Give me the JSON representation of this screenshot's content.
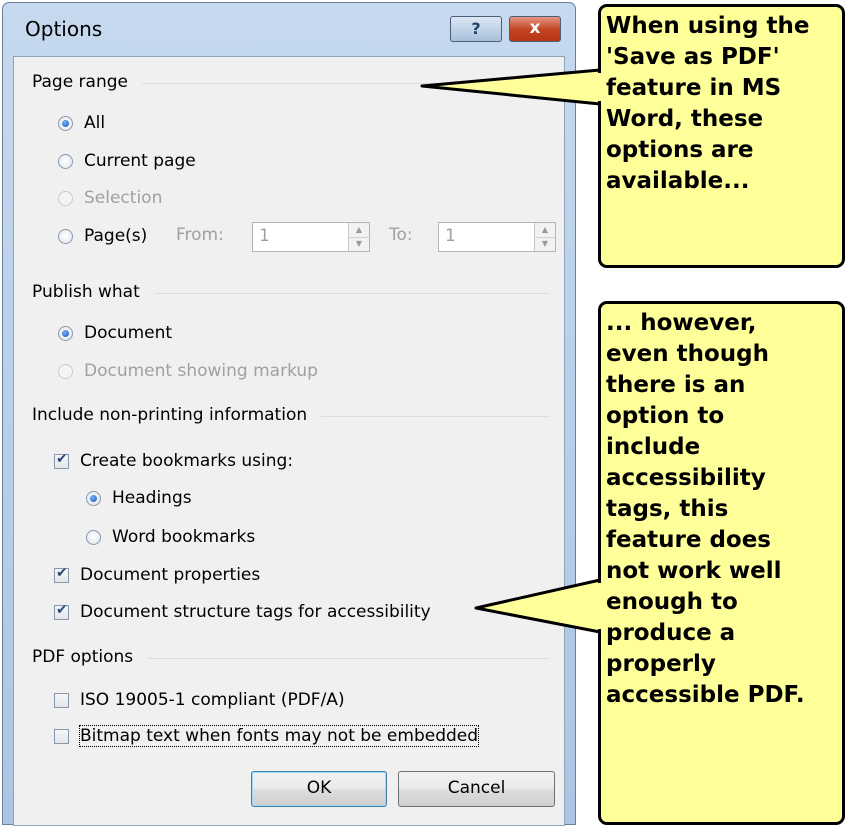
{
  "dialog": {
    "title": "Options",
    "help_glyph": "?",
    "close_glyph": "x"
  },
  "page_range": {
    "header": "Page range",
    "all_label": "All",
    "current_page_label": "Current page",
    "selection_label": "Selection",
    "pages_label": "Page(s)",
    "from_label": "From:",
    "from_value": "1",
    "to_label": "To:",
    "to_value": "1",
    "selected": "All"
  },
  "publish_what": {
    "header": "Publish what",
    "document_label": "Document",
    "document_markup_label": "Document showing markup",
    "selected": "Document"
  },
  "non_printing": {
    "header": "Include non-printing information",
    "create_bookmarks_label": "Create bookmarks using:",
    "create_bookmarks_checked": true,
    "headings_label": "Headings",
    "word_bookmarks_label": "Word bookmarks",
    "bookmark_source_selected": "Headings",
    "doc_properties_label": "Document properties",
    "doc_properties_checked": true,
    "structure_tags_label": "Document structure tags for accessibility",
    "structure_tags_checked": true
  },
  "pdf_options": {
    "header": "PDF options",
    "iso_label": "ISO 19005-1 compliant (PDF/A)",
    "iso_checked": false,
    "bitmap_label": "Bitmap text when fonts may not be embedded",
    "bitmap_checked": false
  },
  "buttons": {
    "ok": "OK",
    "cancel": "Cancel"
  },
  "callouts": {
    "top": "When using the\n'Save as PDF'\nfeature in MS\nWord, these\noptions are\navailable...",
    "bottom": "... however,\neven though\nthere is an\noption to\ninclude\naccessibility\ntags, this\nfeature does\nnot work well\nenough to\nproduce a\nproperly\naccessible PDF.",
    "fill_color": "#ffff99"
  }
}
